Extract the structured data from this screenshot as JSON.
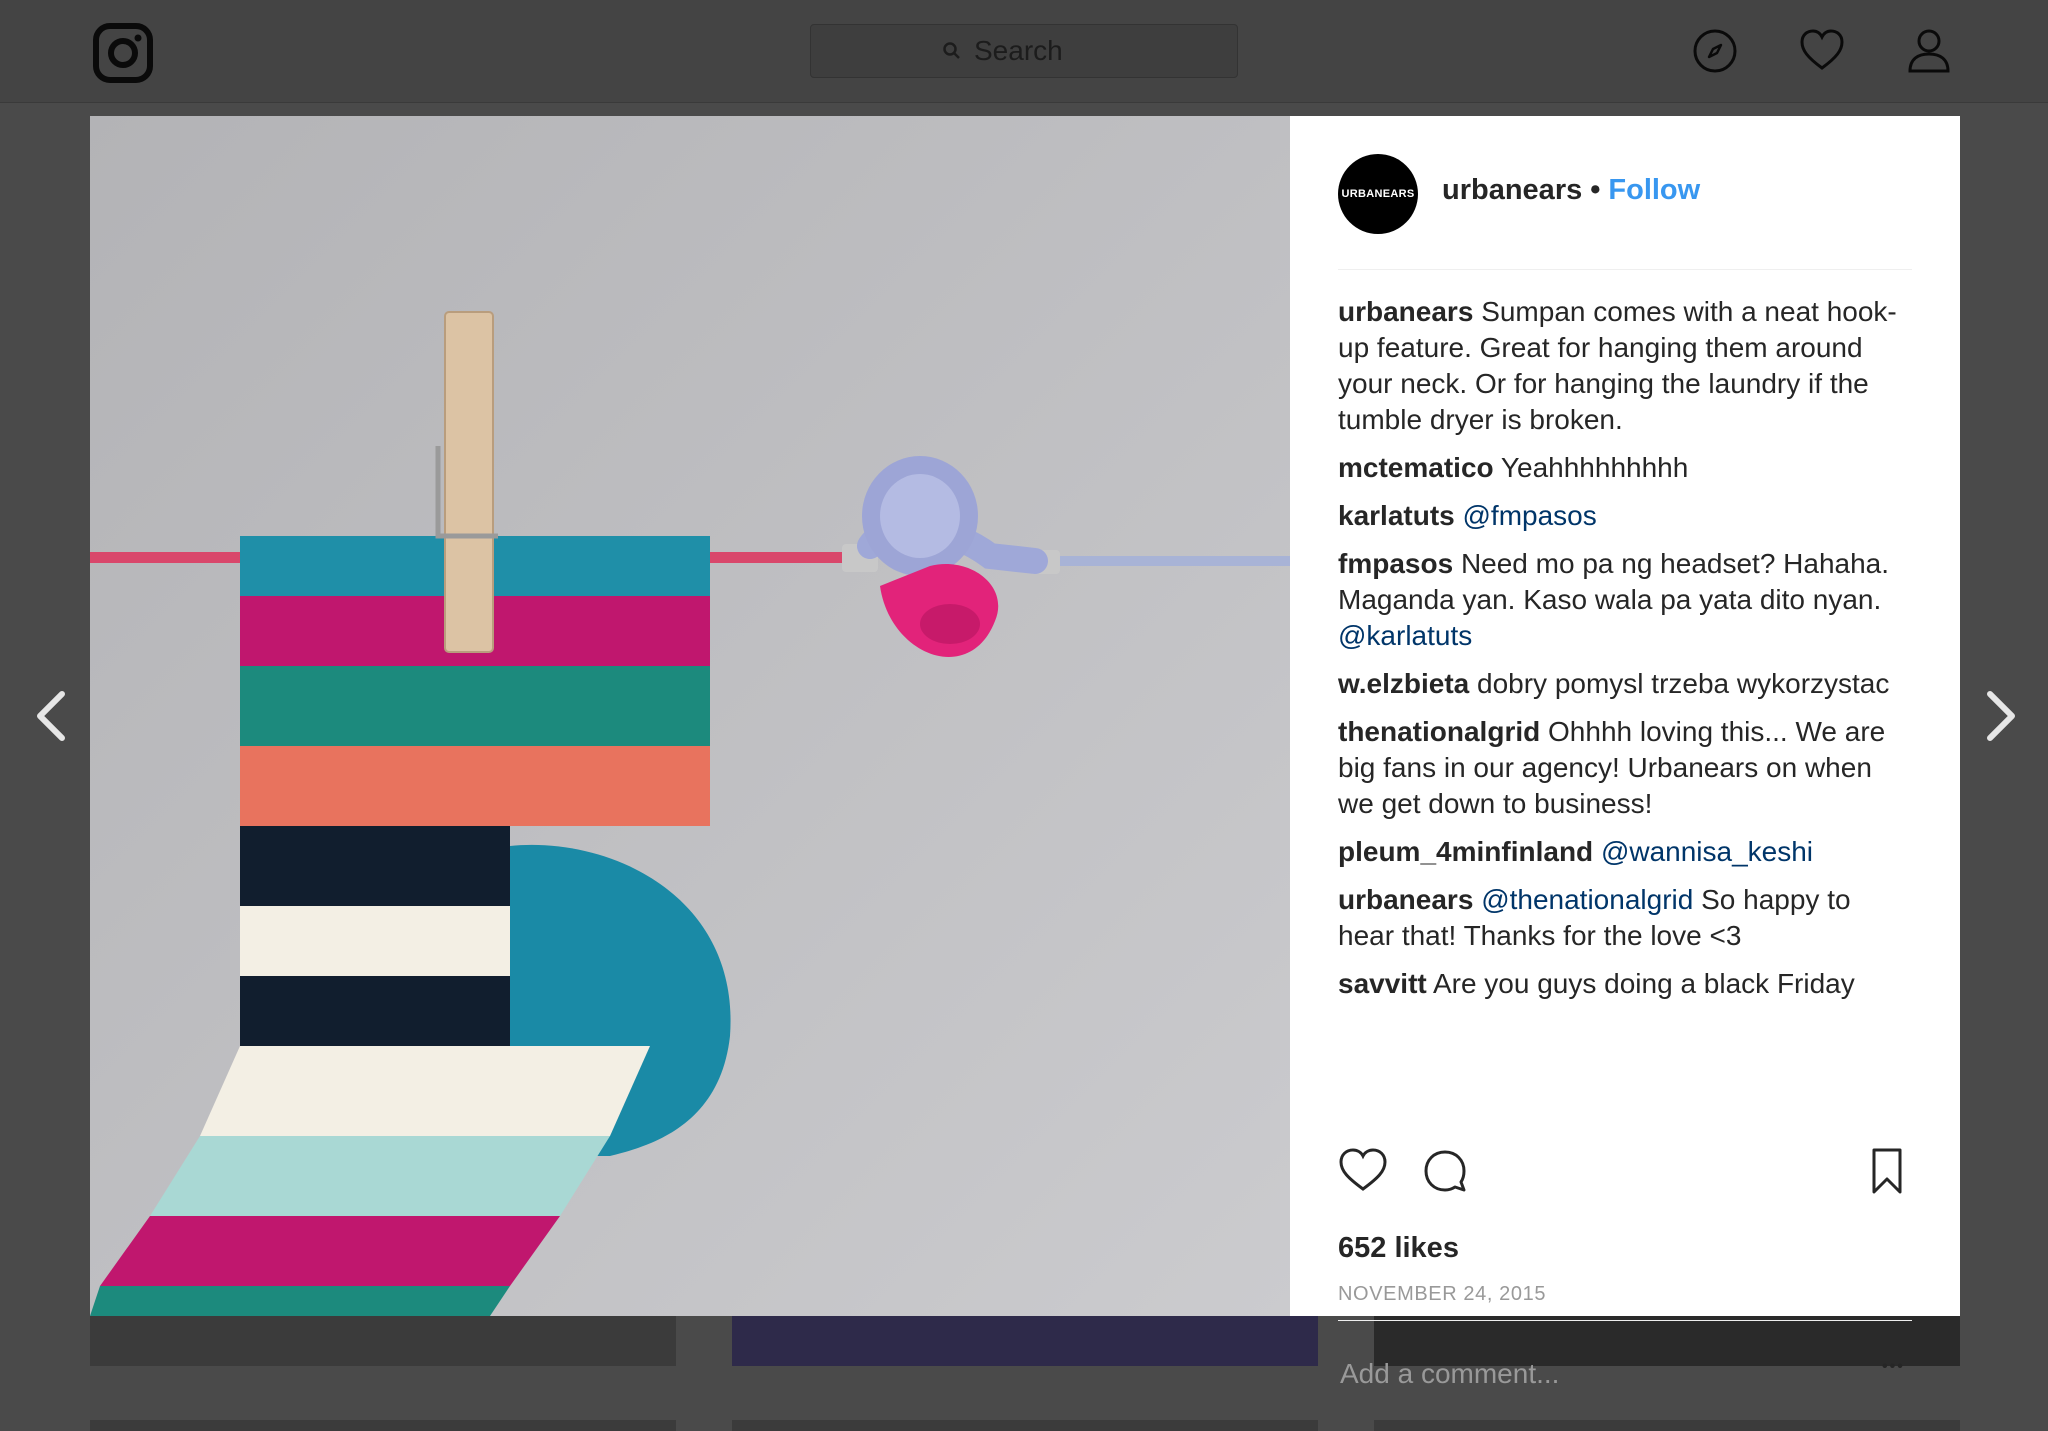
{
  "topbar": {
    "logo_icon": "instagram-logo-icon",
    "search_placeholder": "Search",
    "nav_icons": [
      "compass-icon",
      "heart-icon",
      "profile-icon"
    ]
  },
  "post": {
    "avatar_text": "URBANEARS",
    "username": "urbanears",
    "separator": "•",
    "follow_label": "Follow",
    "comments": [
      {
        "user": "urbanears",
        "text": "Sumpan comes with a neat hook-up feature. Great for hanging them around your neck. Or for hanging the laundry if the tumble dryer is broken."
      },
      {
        "user": "mctematico",
        "text": "Yeahhhhhhhhh"
      },
      {
        "user": "karlatuts",
        "mention": "@fmpasos",
        "text": ""
      },
      {
        "user": "fmpasos",
        "text": "Need mo pa ng headset? Hahaha. Maganda yan. Kaso wala pa yata dito nyan.",
        "mention_after": "@karlatuts"
      },
      {
        "user": "w.elzbieta",
        "text": "dobry pomysl trzeba wykorzystac"
      },
      {
        "user": "thenationalgrid",
        "text": "Ohhhh loving this... We are big fans in our agency! Urbanears on when we get down to business!"
      },
      {
        "user": "pleum_4minfinland",
        "mention": "@wannisa_keshi",
        "text": ""
      },
      {
        "user": "urbanears",
        "mention": "@thenationalgrid",
        "text": "So happy to hear that! Thanks for the love <3"
      },
      {
        "user": "savvitt",
        "text": "Are you guys doing a black Friday"
      }
    ],
    "likes": "652 likes",
    "date": "NOVEMBER 24, 2015",
    "add_comment_placeholder": "Add a comment...",
    "more_label": "•••"
  },
  "colors": {
    "accent": "#3897f0",
    "mention": "#003569",
    "overlay": "#4a4a4a"
  }
}
